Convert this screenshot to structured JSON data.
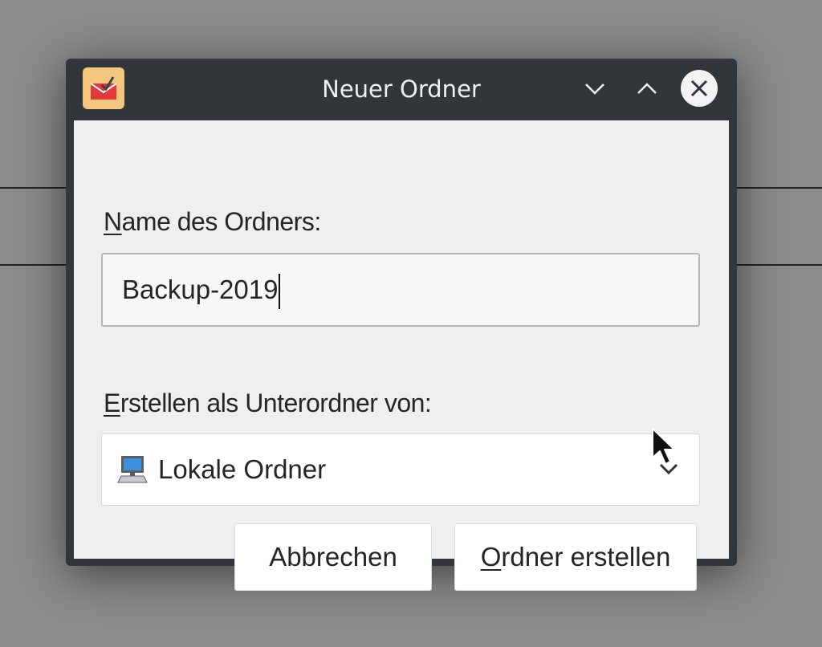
{
  "window": {
    "title": "Neuer Ordner",
    "icons": {
      "app": "mail-app-icon",
      "minimize": "chevron-down-icon",
      "maximize": "chevron-up-icon",
      "close": "close-icon"
    }
  },
  "form": {
    "name_label_mnemonic": "N",
    "name_label_rest": "ame des Ordners:",
    "name_value": "Backup-2019",
    "parent_label_mnemonic": "E",
    "parent_label_rest": "rstellen als Unterordner von:",
    "parent_selected": "Lokale Ordner",
    "parent_icon": "computer-icon"
  },
  "buttons": {
    "cancel_label": "Abbrechen",
    "create_label_mnemonic": "O",
    "create_label_rest": "rdner erstellen"
  },
  "colors": {
    "titlebar": "#31363b",
    "content_bg": "#efefef",
    "app_icon_bg": "#f5c77e",
    "app_icon_red": "#e5383b"
  }
}
